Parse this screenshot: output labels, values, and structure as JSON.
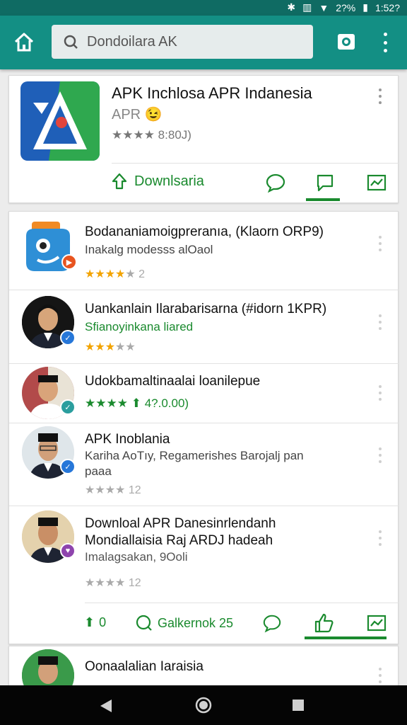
{
  "status_bar": {
    "time": "1:52?",
    "battery": "2?%"
  },
  "app_bar": {
    "search_text": "Dondoilara AK",
    "icons": [
      "home-icon",
      "search-icon",
      "camera-icon",
      "more-vert-icon"
    ]
  },
  "featured": {
    "title": "APK Inchlosa APR Indanesia",
    "subtitle": "APR 😉",
    "rating_text": "★★★★ 8:80J)",
    "download_label": "Downlsaria",
    "colors": {
      "accent": "#1a8a2e",
      "appbar": "#138f84"
    }
  },
  "results": [
    {
      "title": "Bodananiamoigpreranıa, (Klaorn ORP9)",
      "subtitle": "Inakalg modesss alOaol",
      "rating": 3.5,
      "rating_text": "2",
      "badge": "orange"
    },
    {
      "title": "Uankanlain Ilarabarisarna (#idorn 1KPR)",
      "subtitle": "Sfianoyinkana liared",
      "rating": 3,
      "rating_text": "",
      "badge": "blue"
    },
    {
      "title": "Udokbamaltinaalai loanilepue",
      "subtitle": "",
      "rating": 4,
      "rating_text": "4?.0.00)",
      "badge": "teal"
    },
    {
      "title": "APK Inoblania",
      "subtitle": "Kariha AoTıy, Regamerishes Barojalj pan",
      "subtitle2": "paaa",
      "rating": 4,
      "rating_text": "12",
      "badge": "blue"
    },
    {
      "title": "Downloal APR Danesinrlendanh",
      "title2": "Mondiallaisia Raj ARDJ hadeah",
      "subtitle": "Imalagsakan, 9Ooli",
      "rating": 3,
      "rating_text": "12",
      "badge": "purple"
    }
  ],
  "footer_actions": {
    "likes": "0",
    "comments_label": "Galkernok 25"
  },
  "partial_row": {
    "title": "Oonaalalian Iaraisia"
  }
}
